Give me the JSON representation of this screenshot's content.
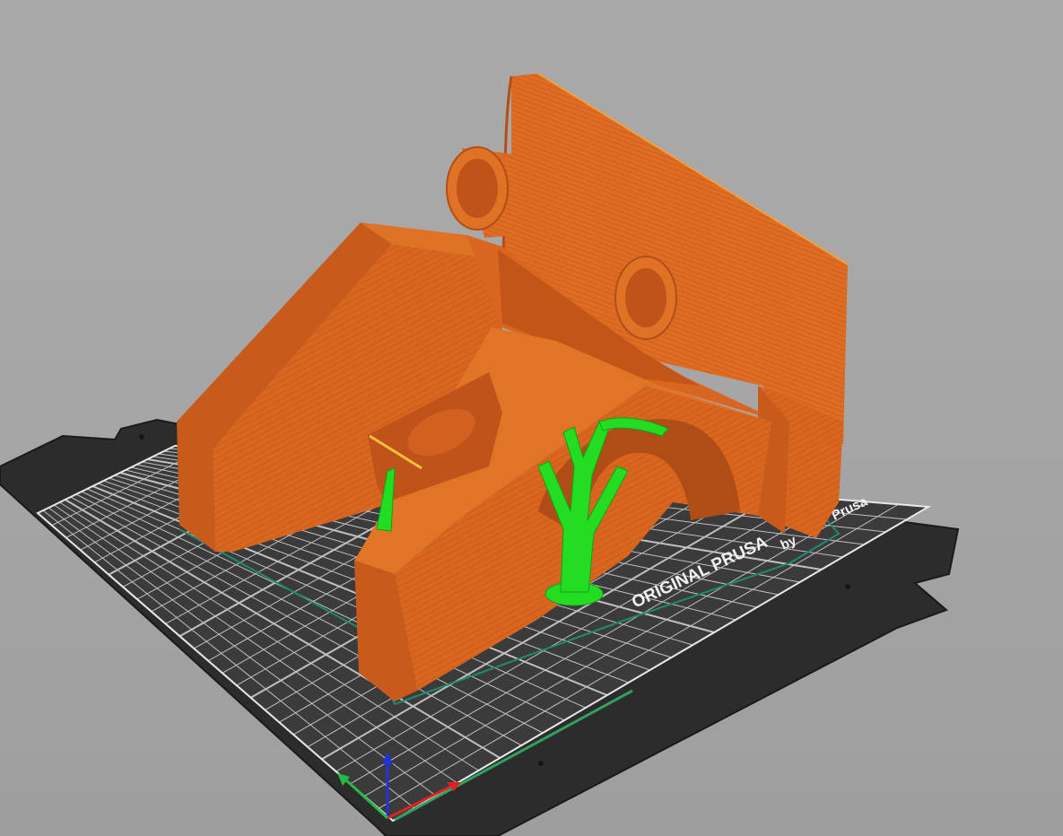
{
  "viewport": {
    "bed": {
      "brand_label": "ORIGINAL PRUSA",
      "maker_label_prefix": "by",
      "maker_label_suffix": "Prusa"
    },
    "colors": {
      "background": "#a8a8a8",
      "bed_plate": "#2b2b2b",
      "grid_line": "#e6e6e6",
      "model": "#d9641e",
      "model_shadow": "#b4501a",
      "supports": "#1fe01f",
      "skirt": "#1f8a6f",
      "axis_x": "#e02020",
      "axis_y": "#20c040",
      "axis_z": "#2020e0"
    },
    "objects": [
      {
        "name": "printed-part",
        "color": "model"
      },
      {
        "name": "tree-support",
        "color": "supports"
      }
    ],
    "axes": [
      "x",
      "y",
      "z"
    ]
  }
}
